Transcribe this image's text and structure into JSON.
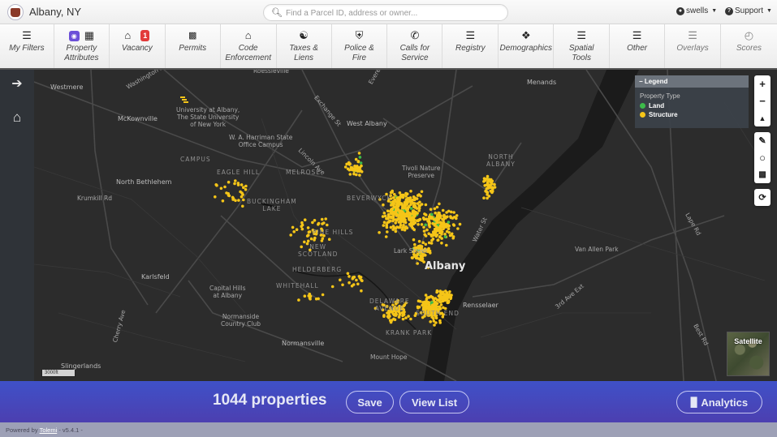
{
  "header": {
    "city_name": "Albany, NY",
    "search_placeholder": "Find a Parcel ID, address or owner...",
    "search_value": "",
    "user_label": "swells",
    "support_label": "Support"
  },
  "toolbar": [
    {
      "id": "my-filters",
      "label": "My Filters",
      "icon": "sliders-icon"
    },
    {
      "id": "property-attributes",
      "label": "Property\nAttributes",
      "icon": "building-icon",
      "badge_icon": "eye-icon"
    },
    {
      "id": "vacancy",
      "label": "Vacancy",
      "icon": "vacant-house-icon",
      "badge": "1"
    },
    {
      "id": "permits",
      "label": "Permits",
      "icon": "document-icon"
    },
    {
      "id": "code-enforcement",
      "label": "Code\nEnforcement",
      "icon": "house-alert-icon"
    },
    {
      "id": "taxes-liens",
      "label": "Taxes &\nLiens",
      "icon": "money-hand-icon"
    },
    {
      "id": "police-fire",
      "label": "Police &\nFire",
      "icon": "badge-shield-icon"
    },
    {
      "id": "calls-for-service",
      "label": "Calls for\nService",
      "icon": "phone-icon"
    },
    {
      "id": "registry",
      "label": "Registry",
      "icon": "list-icon"
    },
    {
      "id": "demographics",
      "label": "Demographics",
      "icon": "people-icon"
    },
    {
      "id": "spatial-tools",
      "label": "Spatial\nTools",
      "icon": "sliders-icon"
    },
    {
      "id": "other",
      "label": "Other",
      "icon": "sliders-icon"
    },
    {
      "id": "overlays",
      "label": "Overlays",
      "icon": "layers-icon",
      "disabled": true
    },
    {
      "id": "scores",
      "label": "Scores",
      "icon": "gauge-icon",
      "disabled": true
    }
  ],
  "sidebar": {
    "expand_icon": "arrow-right-icon",
    "home_icon": "vacant-house-icon"
  },
  "legend": {
    "title": "Legend",
    "subtitle": "Property Type",
    "items": [
      {
        "label": "Land",
        "color": "#3dbb4a"
      },
      {
        "label": "Structure",
        "color": "#f5c518"
      }
    ]
  },
  "map": {
    "scale_label": "3000ft",
    "basemap_toggle_label": "Satellite",
    "labels": [
      {
        "text": "Westmere",
        "cls": "mid"
      },
      {
        "text": "Washington Ave",
        "cls": ""
      },
      {
        "text": "McKownville",
        "cls": "mid"
      },
      {
        "text": "University at Albany,\nThe State University\nof New York",
        "cls": "center"
      },
      {
        "text": "W. A. Harriman State\nOffice Campus",
        "cls": "center"
      },
      {
        "text": "CAMPUS",
        "cls": "caps"
      },
      {
        "text": "EAGLE HILL",
        "cls": "caps"
      },
      {
        "text": "MELROSE",
        "cls": "caps"
      },
      {
        "text": "North Bethlehem",
        "cls": "mid"
      },
      {
        "text": "Krumkill Rd",
        "cls": ""
      },
      {
        "text": "BUCKINGHAM\nLAKE",
        "cls": "caps center"
      },
      {
        "text": "Lincoln Ave",
        "cls": ""
      },
      {
        "text": "Exchange St",
        "cls": ""
      },
      {
        "text": "Everett Rd",
        "cls": ""
      },
      {
        "text": "Roessleville",
        "cls": ""
      },
      {
        "text": "West Albany",
        "cls": "mid"
      },
      {
        "text": "Menands",
        "cls": "mid"
      },
      {
        "text": "Tivoli Nature\nPreserve",
        "cls": "center"
      },
      {
        "text": "NORTH\nALBANY",
        "cls": "caps center"
      },
      {
        "text": "BEVERWYCK",
        "cls": "caps"
      },
      {
        "text": "PINE HILLS",
        "cls": "caps"
      },
      {
        "text": "NEW\nSCOTLAND",
        "cls": "caps center"
      },
      {
        "text": "HELDERBERG",
        "cls": "caps"
      },
      {
        "text": "WHITEHALL",
        "cls": "caps"
      },
      {
        "text": "Lark Street",
        "cls": ""
      },
      {
        "text": "Albany",
        "cls": "big"
      },
      {
        "text": "Water St",
        "cls": ""
      },
      {
        "text": "Karlsfeld",
        "cls": "mid"
      },
      {
        "text": "Capital Hills\nat Albany",
        "cls": "center"
      },
      {
        "text": "Normanside\nCountry Club",
        "cls": "center"
      },
      {
        "text": "Normansville",
        "cls": "mid"
      },
      {
        "text": "DELAWARE\nAVENUE",
        "cls": "caps center"
      },
      {
        "text": "SOUTH END",
        "cls": "caps"
      },
      {
        "text": "KRANK PARK",
        "cls": "caps"
      },
      {
        "text": "Mount Hope",
        "cls": ""
      },
      {
        "text": "Rensselaer",
        "cls": "mid"
      },
      {
        "text": "3rd Ave Ext",
        "cls": ""
      },
      {
        "text": "Van Allen Park",
        "cls": ""
      },
      {
        "text": "Lape Rd",
        "cls": ""
      },
      {
        "text": "Best Rd",
        "cls": ""
      },
      {
        "text": "Slingerlands",
        "cls": "mid"
      },
      {
        "text": "Cherry Ave",
        "cls": ""
      }
    ]
  },
  "results": {
    "count_label": "1044 properties",
    "save_label": "Save",
    "view_list_label": "View List",
    "analytics_label": "Analytics"
  },
  "footer": {
    "prefix": "Powered by ",
    "brand": "Tolemi",
    "version": " - v5.4.1 -"
  }
}
